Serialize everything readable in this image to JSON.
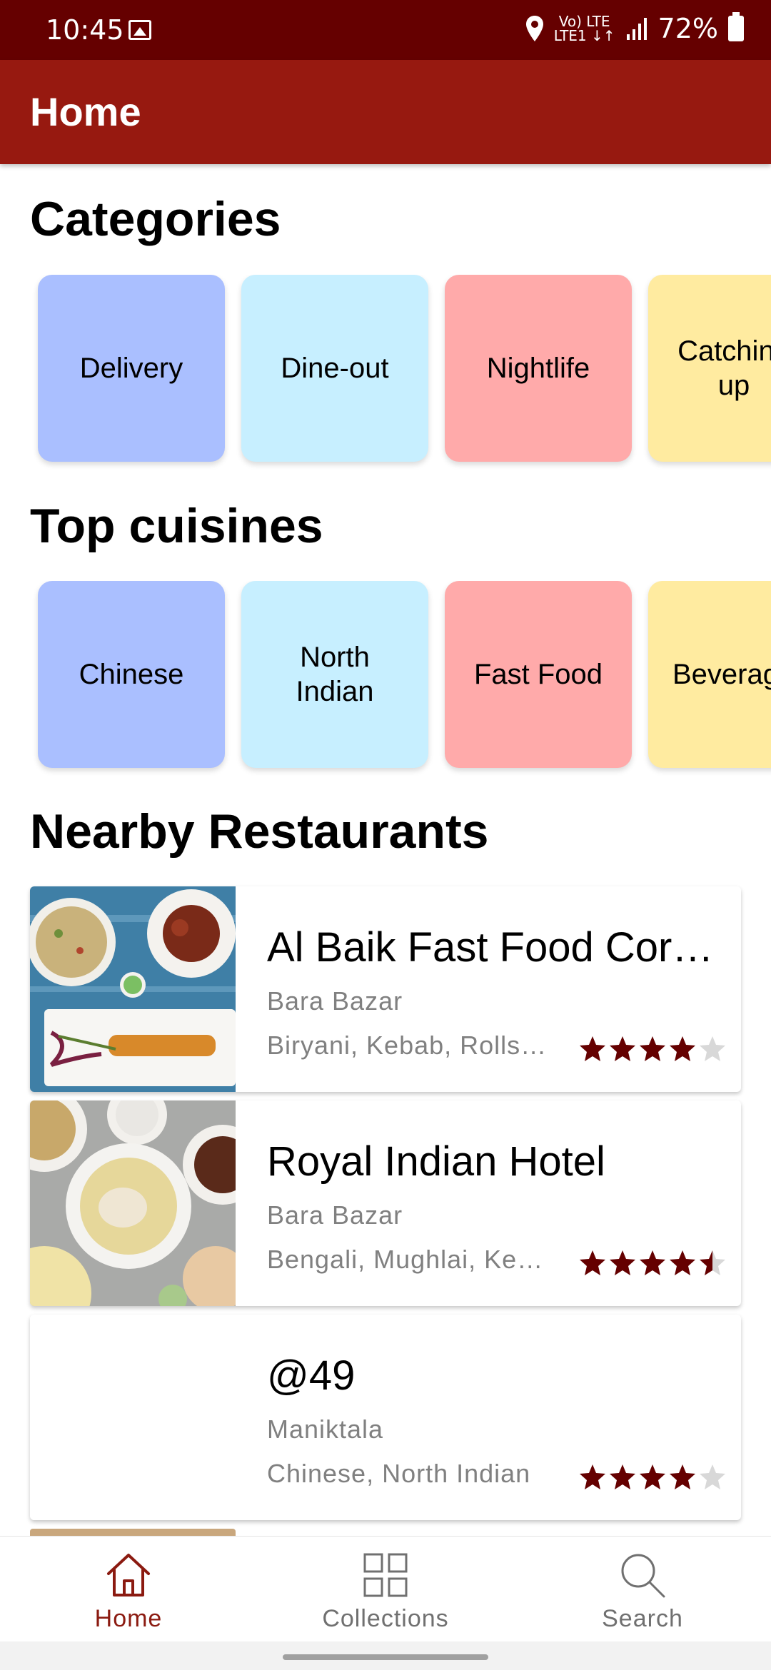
{
  "status_bar": {
    "time": "10:45",
    "network_line1": "Vo) LTE",
    "network_line2": "LTE1 ↓↑",
    "battery": "72%"
  },
  "app_bar": {
    "title": "Home"
  },
  "categories": {
    "title": "Categories",
    "items": [
      {
        "label": "Delivery",
        "color": "#aabfff"
      },
      {
        "label": "Dine-out",
        "color": "#c7efff"
      },
      {
        "label": "Nightlife",
        "color": "#ffaaaa"
      },
      {
        "label": "Catching up",
        "color": "#ffeba0"
      }
    ]
  },
  "cuisines": {
    "title": "Top cuisines",
    "items": [
      {
        "label": "Chinese",
        "color": "#aabfff"
      },
      {
        "label": "North Indian",
        "color": "#c7efff"
      },
      {
        "label": "Fast Food",
        "color": "#ffaaaa"
      },
      {
        "label": "Beverages",
        "color": "#ffeba0"
      }
    ]
  },
  "nearby": {
    "title": "Nearby Restaurants",
    "restaurants": [
      {
        "name": "Al Baik Fast Food Corner",
        "area": "Bara Bazar",
        "cuisines": "Biryani, Kebab, Rolls, Chinese",
        "rating": 4.0
      },
      {
        "name": "Royal Indian Hotel",
        "area": "Bara Bazar",
        "cuisines": "Bengali, Mughlai, Kebab",
        "rating": 4.5
      },
      {
        "name": "@49",
        "area": "Maniktala",
        "cuisines": "Chinese, North Indian",
        "rating": 4.0
      }
    ]
  },
  "bottom_nav": {
    "items": [
      {
        "label": "Home",
        "icon": "home-icon",
        "active": true
      },
      {
        "label": "Collections",
        "icon": "grid-icon",
        "active": false
      },
      {
        "label": "Search",
        "icon": "search-icon",
        "active": false
      }
    ]
  },
  "colors": {
    "status_bar": "#650000",
    "app_bar": "#971910",
    "accent": "#8b1a10",
    "star_filled": "#650000",
    "star_empty": "#d8d8d8",
    "nav_inactive": "#707070"
  }
}
